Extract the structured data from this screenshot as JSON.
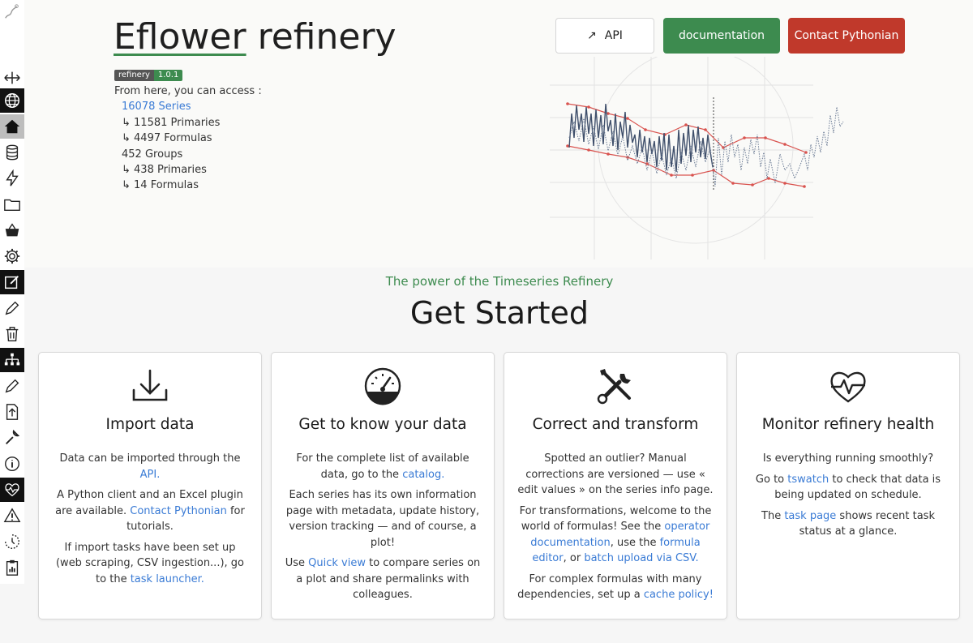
{
  "header": {
    "title_brand": "Eflower",
    "title_rest": " refinery",
    "badge_name": "refinery",
    "badge_version": "1.0.1",
    "intro": "From here, you can access :",
    "series_link": "16078 Series",
    "series_primaries": "↳ 11581 Primaries",
    "series_formulas": "↳ 4497 Formulas",
    "groups": "452 Groups",
    "groups_primaries": "↳ 438 Primaries",
    "groups_formulas": "↳ 14 Formulas"
  },
  "buttons": {
    "api": "API",
    "api_icon": "↗",
    "documentation": "documentation",
    "contact": "Contact Pythonian"
  },
  "tagline": "The power of the Timeseries Refinery",
  "get_started": "Get Started",
  "cards": {
    "import": {
      "title": "Import data",
      "p1_a": "Data can be imported through the ",
      "p1_link": "API.",
      "p2_a": "A Python client and an Excel plugin are available. ",
      "p2_link": "Contact Pythonian",
      "p2_b": " for tutorials.",
      "p3_a": "If import tasks have been set up (web scraping, CSV ingestion...), go to the ",
      "p3_link": "task launcher."
    },
    "know": {
      "title": "Get to know your data",
      "p1_a": "For the complete list of available data, go to the ",
      "p1_link": "catalog.",
      "p2": "Each series has its own information page with metadata, update history, version tracking — and of course, a plot!",
      "p3_a": "Use ",
      "p3_link": "Quick view",
      "p3_b": " to compare series on a plot and share permalinks with colleagues."
    },
    "correct": {
      "title": "Correct and transform",
      "p1": "Spotted an outlier? Manual corrections are versioned — use « edit values » on the series info page.",
      "p2_a": "For transformations, welcome to the world of formulas! See the ",
      "p2_link1": "operator documentation",
      "p2_b": ", use the ",
      "p2_link2": "formula editor",
      "p2_c": ", or ",
      "p2_link3": "batch upload via CSV.",
      "p3_a": "For complex formulas with many dependencies, set up a ",
      "p3_link": "cache policy!"
    },
    "monitor": {
      "title": "Monitor refinery health",
      "p1": "Is everything running smoothly?",
      "p2_a": "Go to ",
      "p2_link": "tswatch",
      "p2_b": " to check that data is being updated on schedule.",
      "p3_a": "The ",
      "p3_link": "task page",
      "p3_b": " shows recent task status at a glance."
    }
  },
  "colors": {
    "green": "#3d8b4f",
    "red": "#c0392b",
    "link": "#3a7bd5"
  }
}
